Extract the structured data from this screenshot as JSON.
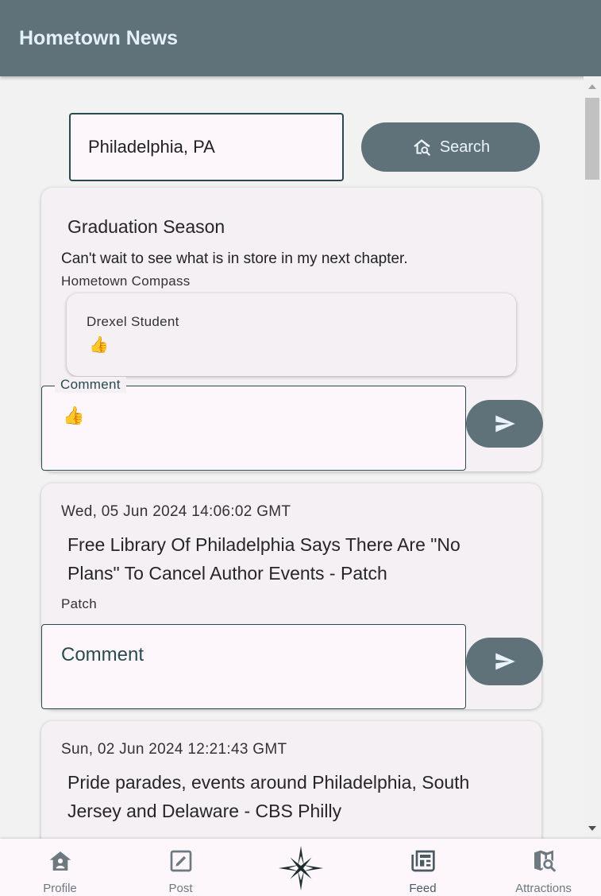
{
  "app": {
    "title": "Hometown News"
  },
  "location": {
    "value": "Philadelphia, PA"
  },
  "search": {
    "label": "Search",
    "icon": "home-search-icon"
  },
  "posts": [
    {
      "title": "Graduation Season",
      "body": "Can't wait to see what is in store in my next chapter.",
      "source": "Hometown Compass",
      "comments": [
        {
          "author": "Drexel Student",
          "text": "👍"
        }
      ],
      "comment_field": {
        "label": "Comment",
        "value": "👍"
      }
    },
    {
      "date": "Wed, 05 Jun 2024 14:06:02 GMT",
      "title": "Free Library Of Philadelphia Says There Are \"No Plans\" To Cancel Author Events - Patch",
      "source": "Patch",
      "comment_field": {
        "placeholder": "Comment"
      }
    },
    {
      "date": "Sun, 02 Jun 2024 12:21:43 GMT",
      "title": "Pride parades, events around Philadelphia, South Jersey and Delaware - CBS Philly"
    }
  ],
  "nav": {
    "items": [
      {
        "label": "Profile",
        "icon": "profile-home-icon"
      },
      {
        "label": "Post",
        "icon": "edit-icon"
      },
      {
        "label": "",
        "icon": "compass-logo-icon"
      },
      {
        "label": "Feed",
        "icon": "newspaper-icon"
      },
      {
        "label": "Attractions",
        "icon": "map-search-icon"
      }
    ]
  },
  "colors": {
    "primary": "#607279",
    "accent_text": "#e4f1fb",
    "card_bg": "#f4f0f4",
    "field_bg": "#fdf7fc",
    "border": "#2a4a50"
  }
}
